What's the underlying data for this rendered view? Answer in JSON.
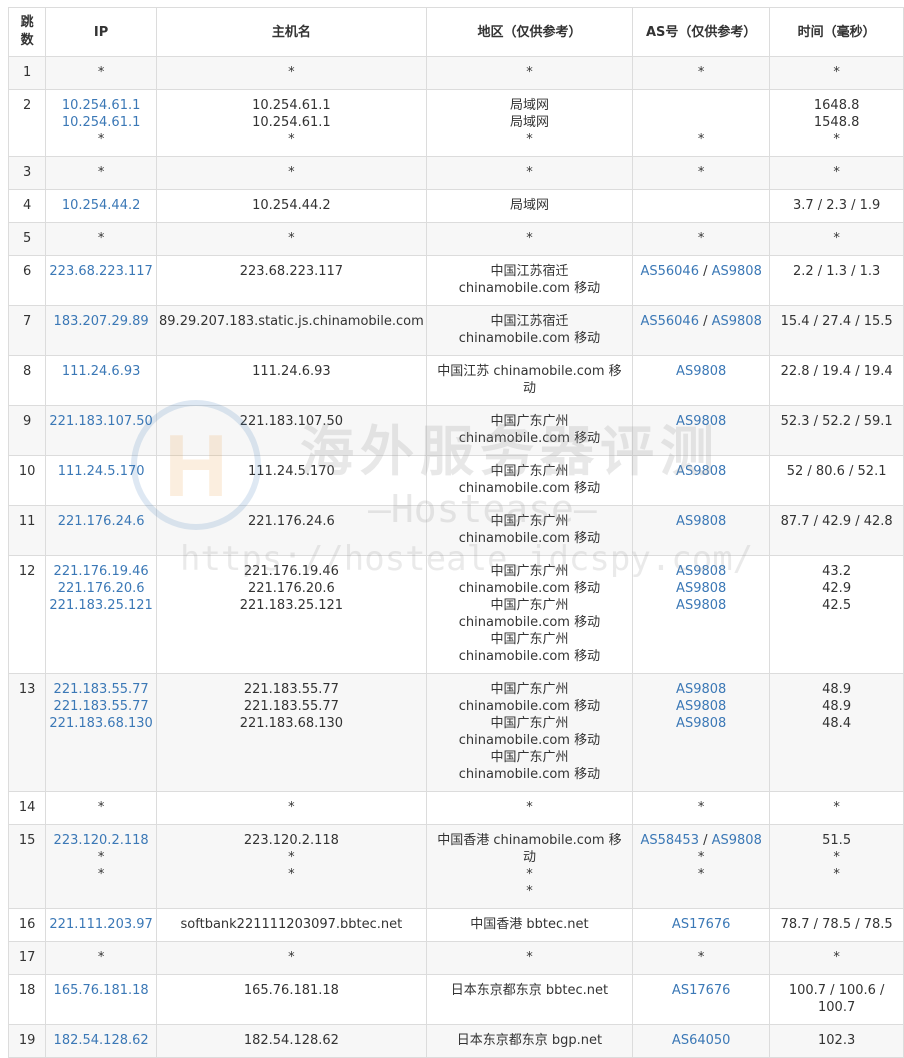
{
  "headers": {
    "hop": "跳数",
    "ip": "IP",
    "host": "主机名",
    "geo": "地区（仅供参考）",
    "as": "AS号（仅供参考）",
    "time": "时间（毫秒）"
  },
  "watermark": {
    "title": "海外服务器评测",
    "subtitle": "—Hostease—",
    "url": "https://hosteale.idcspy.com/"
  },
  "rows": [
    {
      "hop": "1",
      "ip": [
        "*"
      ],
      "host": [
        "*"
      ],
      "geo": [
        "*"
      ],
      "as": [
        [
          "*"
        ]
      ],
      "time": [
        "*"
      ]
    },
    {
      "hop": "2",
      "ip": [
        "10.254.61.1",
        "10.254.61.1",
        "*"
      ],
      "host": [
        "10.254.61.1",
        "10.254.61.1",
        "*"
      ],
      "geo": [
        "局域网",
        "局域网",
        "*"
      ],
      "as": [
        [
          ""
        ],
        [
          ""
        ],
        [
          "*"
        ]
      ],
      "time": [
        "1648.8",
        "1548.8",
        "*"
      ]
    },
    {
      "hop": "3",
      "ip": [
        "*"
      ],
      "host": [
        "*"
      ],
      "geo": [
        "*"
      ],
      "as": [
        [
          "*"
        ]
      ],
      "time": [
        "*"
      ]
    },
    {
      "hop": "4",
      "ip": [
        "10.254.44.2"
      ],
      "host": [
        "10.254.44.2"
      ],
      "geo": [
        "局域网"
      ],
      "as": [
        [
          ""
        ]
      ],
      "time": [
        "3.7 / 2.3 / 1.9"
      ]
    },
    {
      "hop": "5",
      "ip": [
        "*"
      ],
      "host": [
        "*"
      ],
      "geo": [
        "*"
      ],
      "as": [
        [
          "*"
        ]
      ],
      "time": [
        "*"
      ]
    },
    {
      "hop": "6",
      "ip": [
        "223.68.223.117"
      ],
      "host": [
        "223.68.223.117"
      ],
      "geo": [
        "中国江苏宿迁 chinamobile.com 移动"
      ],
      "as": [
        [
          "AS56046",
          "AS9808"
        ]
      ],
      "time": [
        "2.2 / 1.3 / 1.3"
      ]
    },
    {
      "hop": "7",
      "ip": [
        "183.207.29.89"
      ],
      "host": [
        "89.29.207.183.static.js.chinamobile.com"
      ],
      "geo": [
        "中国江苏宿迁 chinamobile.com 移动"
      ],
      "as": [
        [
          "AS56046",
          "AS9808"
        ]
      ],
      "time": [
        "15.4 / 27.4 / 15.5"
      ]
    },
    {
      "hop": "8",
      "ip": [
        "111.24.6.93"
      ],
      "host": [
        "111.24.6.93"
      ],
      "geo": [
        "中国江苏 chinamobile.com 移动"
      ],
      "as": [
        [
          "AS9808"
        ]
      ],
      "time": [
        "22.8 / 19.4 / 19.4"
      ]
    },
    {
      "hop": "9",
      "ip": [
        "221.183.107.50"
      ],
      "host": [
        "221.183.107.50"
      ],
      "geo": [
        "中国广东广州 chinamobile.com 移动"
      ],
      "as": [
        [
          "AS9808"
        ]
      ],
      "time": [
        "52.3 / 52.2 / 59.1"
      ]
    },
    {
      "hop": "10",
      "ip": [
        "111.24.5.170"
      ],
      "host": [
        "111.24.5.170"
      ],
      "geo": [
        "中国广东广州 chinamobile.com 移动"
      ],
      "as": [
        [
          "AS9808"
        ]
      ],
      "time": [
        "52 / 80.6 / 52.1"
      ]
    },
    {
      "hop": "11",
      "ip": [
        "221.176.24.6"
      ],
      "host": [
        "221.176.24.6"
      ],
      "geo": [
        "中国广东广州 chinamobile.com 移动"
      ],
      "as": [
        [
          "AS9808"
        ]
      ],
      "time": [
        "87.7 / 42.9 / 42.8"
      ]
    },
    {
      "hop": "12",
      "ip": [
        "221.176.19.46",
        "221.176.20.6",
        "221.183.25.121"
      ],
      "host": [
        "221.176.19.46",
        "221.176.20.6",
        "221.183.25.121"
      ],
      "geo": [
        "中国广东广州 chinamobile.com 移动",
        "中国广东广州 chinamobile.com 移动",
        "中国广东广州 chinamobile.com 移动"
      ],
      "as": [
        [
          "AS9808"
        ],
        [
          "AS9808"
        ],
        [
          "AS9808"
        ]
      ],
      "time": [
        "43.2",
        "42.9",
        "42.5"
      ]
    },
    {
      "hop": "13",
      "ip": [
        "221.183.55.77",
        "221.183.55.77",
        "221.183.68.130"
      ],
      "host": [
        "221.183.55.77",
        "221.183.55.77",
        "221.183.68.130"
      ],
      "geo": [
        "中国广东广州 chinamobile.com 移动",
        "中国广东广州 chinamobile.com 移动",
        "中国广东广州 chinamobile.com 移动"
      ],
      "as": [
        [
          "AS9808"
        ],
        [
          "AS9808"
        ],
        [
          "AS9808"
        ]
      ],
      "time": [
        "48.9",
        "48.9",
        "48.4"
      ]
    },
    {
      "hop": "14",
      "ip": [
        "*"
      ],
      "host": [
        "*"
      ],
      "geo": [
        "*"
      ],
      "as": [
        [
          "*"
        ]
      ],
      "time": [
        "*"
      ]
    },
    {
      "hop": "15",
      "ip": [
        "223.120.2.118",
        "*",
        "*"
      ],
      "host": [
        "223.120.2.118",
        "*",
        "*"
      ],
      "geo": [
        "中国香港 chinamobile.com 移动",
        "*",
        "*"
      ],
      "as": [
        [
          "AS58453",
          "AS9808"
        ],
        [
          "*"
        ],
        [
          "*"
        ]
      ],
      "time": [
        "51.5",
        "*",
        "*"
      ]
    },
    {
      "hop": "16",
      "ip": [
        "221.111.203.97"
      ],
      "host": [
        "softbank221111203097.bbtec.net"
      ],
      "geo": [
        "中国香港 bbtec.net"
      ],
      "as": [
        [
          "AS17676"
        ]
      ],
      "time": [
        "78.7 / 78.5 / 78.5"
      ]
    },
    {
      "hop": "17",
      "ip": [
        "*"
      ],
      "host": [
        "*"
      ],
      "geo": [
        "*"
      ],
      "as": [
        [
          "*"
        ]
      ],
      "time": [
        "*"
      ]
    },
    {
      "hop": "18",
      "ip": [
        "165.76.181.18"
      ],
      "host": [
        "165.76.181.18"
      ],
      "geo": [
        "日本东京都东京 bbtec.net"
      ],
      "as": [
        [
          "AS17676"
        ]
      ],
      "time": [
        "100.7 / 100.6 / 100.7"
      ]
    },
    {
      "hop": "19",
      "ip": [
        "182.54.128.62"
      ],
      "host": [
        "182.54.128.62"
      ],
      "geo": [
        "日本东京都东京 bgp.net"
      ],
      "as": [
        [
          "AS64050"
        ]
      ],
      "time": [
        "102.3"
      ]
    }
  ]
}
